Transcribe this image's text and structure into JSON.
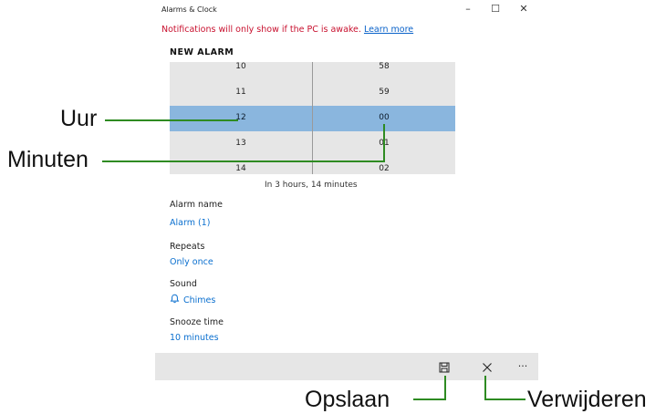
{
  "window": {
    "title": "Alarms & Clock",
    "minimize": "–",
    "maximize": "☐",
    "close": "✕"
  },
  "notification": {
    "text": "Notifications will only show if the PC is awake.",
    "link": "Learn more"
  },
  "heading": "NEW ALARM",
  "picker": {
    "hours": [
      "10",
      "11",
      "12",
      "13",
      "14"
    ],
    "minutes": [
      "58",
      "59",
      "00",
      "01",
      "02"
    ],
    "selected_hour": "12",
    "selected_minute": "00"
  },
  "countdown": "In 3 hours, 14 minutes",
  "fields": {
    "alarm_name_label": "Alarm name",
    "alarm_name_value": "Alarm (1)",
    "repeats_label": "Repeats",
    "repeats_value": "Only once",
    "sound_label": "Sound",
    "sound_value": "Chimes",
    "snooze_label": "Snooze time",
    "snooze_value": "10 minutes"
  },
  "commandbar": {
    "icons": [
      "save-icon",
      "close-icon",
      "more-icon"
    ],
    "more": "···"
  },
  "annotations": {
    "uur": "Uur",
    "minuten": "Minuten",
    "opslaan": "Opslaan",
    "verwijderen": "Verwijderen"
  },
  "colors": {
    "selection": "#8ab6de",
    "accent_link": "#0a6fcf",
    "warning": "#c8102e",
    "callout": "#2e8b22"
  }
}
